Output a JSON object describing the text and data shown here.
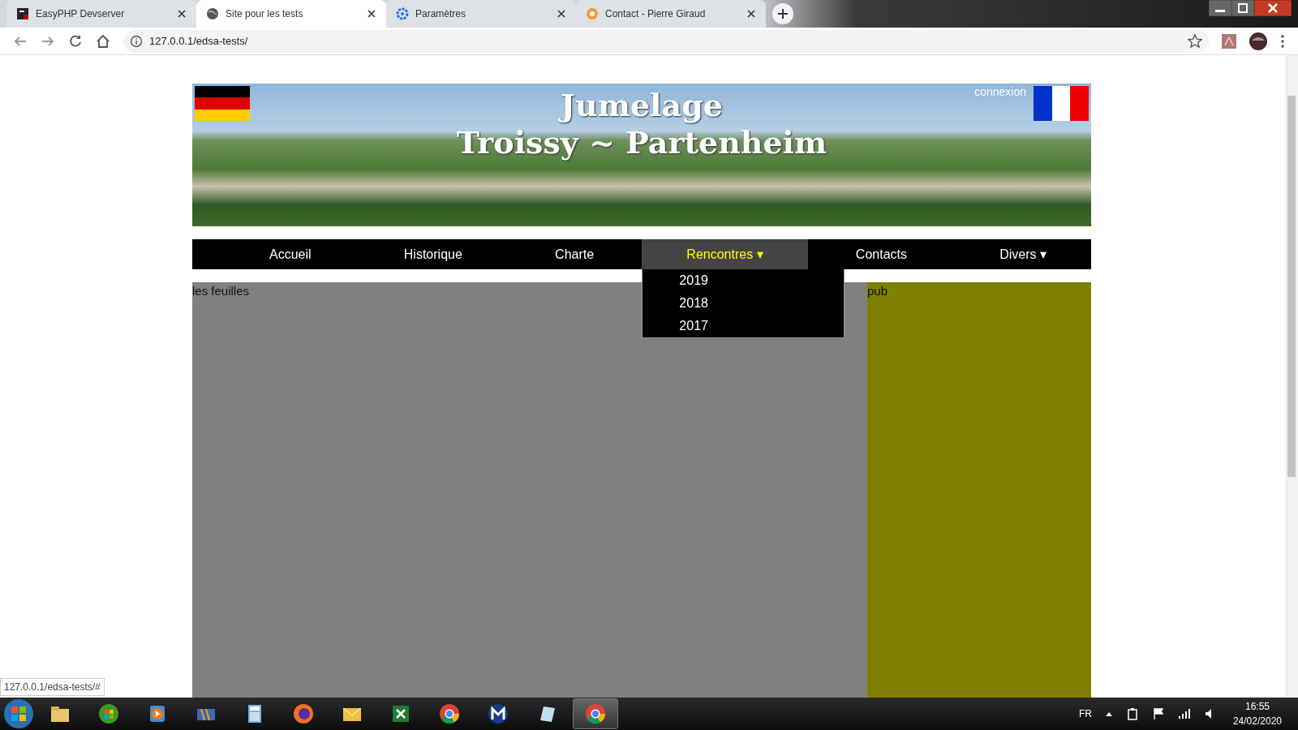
{
  "browser": {
    "tabs": [
      {
        "title": "EasyPHP Devserver",
        "kind": "easyphp",
        "selected": false
      },
      {
        "title": "Site pour les tests",
        "kind": "globe",
        "selected": true
      },
      {
        "title": "Paramètres",
        "kind": "gear",
        "selected": false
      },
      {
        "title": "Contact - Pierre Giraud",
        "kind": "pg",
        "selected": false
      }
    ],
    "address": "127.0.0.1/edsa-tests/",
    "status_url": "127.0.0.1/edsa-tests/#"
  },
  "page": {
    "banner": {
      "title_line_1": "Jumelage",
      "title_line_2": "Troissy ~ Partenheim",
      "login_link": "connexion"
    },
    "nav": [
      {
        "label": "Accueil",
        "selected": false
      },
      {
        "label": "Historique",
        "selected": false
      },
      {
        "label": "Charte",
        "selected": false
      },
      {
        "label": "Rencontres ▾",
        "selected": true,
        "expanded": true
      },
      {
        "label": "Contacts",
        "selected": false
      },
      {
        "label": "Divers ▾",
        "selected": false,
        "expanded": false
      }
    ],
    "dropdown": [
      "2019",
      "2018",
      "2017"
    ],
    "main_panel": "les feuilles",
    "side_panel": "pub"
  },
  "taskbar": {
    "apps": [
      {
        "kind": "folder",
        "selected": false
      },
      {
        "kind": "media-center",
        "selected": false
      },
      {
        "kind": "media-player",
        "selected": false
      },
      {
        "kind": "movie-maker",
        "selected": false
      },
      {
        "kind": "calculator",
        "selected": false
      },
      {
        "kind": "firefox",
        "selected": false
      },
      {
        "kind": "mail",
        "selected": false
      },
      {
        "kind": "spreadsheet",
        "selected": false
      },
      {
        "kind": "chrome",
        "selected": false
      },
      {
        "kind": "m-app",
        "selected": false
      },
      {
        "kind": "notepad",
        "selected": false
      },
      {
        "kind": "chrome",
        "selected": true
      }
    ],
    "language": "FR",
    "time": "16:55",
    "date": "24/02/2020"
  }
}
